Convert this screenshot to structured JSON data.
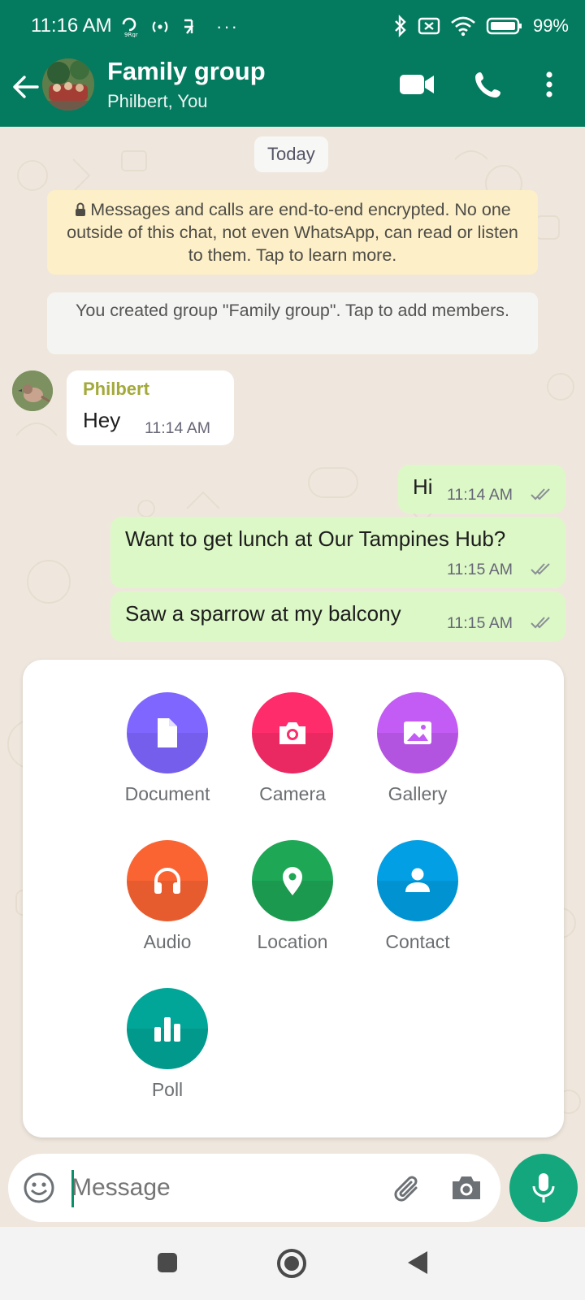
{
  "status_bar": {
    "time": "11:16 AM",
    "battery": "99%",
    "dots": "···"
  },
  "header": {
    "title": "Family group",
    "subtitle": "Philbert, You"
  },
  "chat": {
    "date_chip": "Today",
    "encryption_notice": "Messages and calls are end-to-end encrypted. No one outside of this chat, not even WhatsApp, can read or listen to them. Tap to learn more.",
    "group_notice": "You created group \"Family group\". Tap to add members.",
    "messages": [
      {
        "sender": "Philbert",
        "text": "Hey",
        "time": "11:14 AM",
        "direction": "in"
      },
      {
        "text": "Hi",
        "time": "11:14 AM",
        "direction": "out"
      },
      {
        "text": "Want to get lunch at Our Tampines Hub?",
        "time": "11:15 AM",
        "direction": "out"
      },
      {
        "text": "Saw a sparrow at my balcony",
        "time": "11:15 AM",
        "direction": "out"
      }
    ]
  },
  "attach_menu": {
    "items": [
      {
        "label": "Document",
        "icon": "document-icon",
        "color": "#7f66ff"
      },
      {
        "label": "Camera",
        "icon": "camera-icon",
        "color": "#fe2c6b"
      },
      {
        "label": "Gallery",
        "icon": "gallery-icon",
        "color": "#c35cf4"
      },
      {
        "label": "Audio",
        "icon": "headphones-icon",
        "color": "#fa6433"
      },
      {
        "label": "Location",
        "icon": "location-pin-icon",
        "color": "#1ea755"
      },
      {
        "label": "Contact",
        "icon": "person-icon",
        "color": "#029fe4"
      },
      {
        "label": "Poll",
        "icon": "poll-icon",
        "color": "#02a698"
      }
    ]
  },
  "composer": {
    "placeholder": "Message"
  },
  "colors": {
    "header": "#047b5f",
    "outgoing_bubble": "#dcf8c6",
    "incoming_bubble": "#ffffff",
    "encryption_notice_bg": "#fdefc7",
    "mic_button": "#14a77d",
    "sender_name": "#a3a93a",
    "read_ticks": "#8a8f96"
  }
}
